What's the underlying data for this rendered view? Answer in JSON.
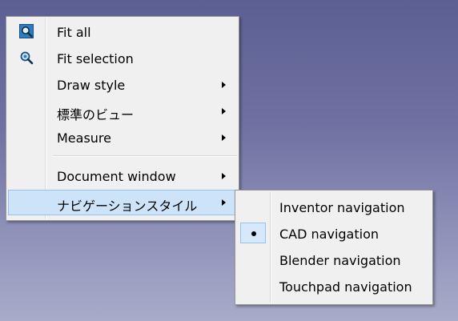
{
  "main_menu": {
    "items": [
      {
        "label": "Fit all",
        "icon": "fit-all-icon"
      },
      {
        "label": "Fit selection",
        "icon": "fit-selection-icon"
      },
      {
        "label": "Draw style",
        "has_submenu": true
      },
      {
        "label": "標準のビュー",
        "has_submenu": true
      },
      {
        "label": "Measure",
        "has_submenu": true
      },
      {
        "label": "Document window",
        "has_submenu": true
      },
      {
        "label": "ナビゲーションスタイル",
        "has_submenu": true,
        "highlighted": true
      }
    ]
  },
  "navigation_submenu": {
    "items": [
      {
        "label": "Inventor navigation",
        "checked": false
      },
      {
        "label": "CAD navigation",
        "checked": true
      },
      {
        "label": "Blender navigation",
        "checked": false
      },
      {
        "label": "Touchpad navigation",
        "checked": false
      }
    ]
  },
  "colors": {
    "background_top": "#5c5f92",
    "background_bottom": "#a9abc9",
    "menu_bg": "#f0f0f0",
    "highlight_bg": "#cde3f7",
    "highlight_border": "#96c3ee"
  }
}
